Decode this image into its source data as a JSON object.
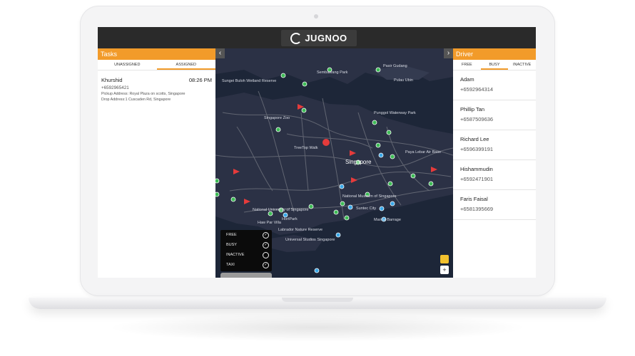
{
  "app": {
    "logo_text": "JUGNOO"
  },
  "tasks_panel": {
    "title": "Tasks",
    "tabs": [
      {
        "label": "UNASSIGNED",
        "active": false
      },
      {
        "label": "ASSIGNED",
        "active": true
      }
    ],
    "items": [
      {
        "name": "Khurshid",
        "time": "08:26 PM",
        "phone": "+6592965421",
        "pickup": "Pickup Address: Royal Plaza on scotts, Singapore",
        "drop": "Drop Address:1 Cuscaden Rd, Singapore"
      }
    ]
  },
  "driver_panel": {
    "title": "Driver",
    "tabs": [
      {
        "label": "FREE",
        "active": false
      },
      {
        "label": "BUSY",
        "active": true
      },
      {
        "label": "INACTIVE",
        "active": false
      }
    ],
    "drivers": [
      {
        "name": "Adam",
        "phone": "+6592964314"
      },
      {
        "name": "Phillip Tan",
        "phone": "+6587509636"
      },
      {
        "name": "Richard Lee",
        "phone": "+6596399191"
      },
      {
        "name": "Hishammudin",
        "phone": "+6592471901"
      },
      {
        "name": "Faris Faisal",
        "phone": "+6581395669"
      }
    ]
  },
  "map": {
    "nav_prev": "‹",
    "nav_next": "›",
    "zoom_in": "+",
    "labels": {
      "singapore": "Singapore",
      "pulau_ubin": "Pulau Ubin",
      "pasir_gudang": "Pasir Gudang",
      "sembawang_park": "Sembawang Park",
      "sungei_buloh": "Sungei Buloh Wetland Reserve",
      "singapore_zoo": "Singapore Zoo",
      "punggol": "Punggol Waterway Park",
      "treetop": "TreeTop Walk",
      "paya_lebar": "Paya Lebar Air Base",
      "hort_park": "HortPark",
      "labrador": "Labrador Nature Reserve",
      "national_museum": "National Museum of Singapore",
      "suntec": "Suntec City",
      "marina": "Marina Barrage",
      "universal": "Universal Studios Singapore",
      "nus": "National University of Singapore",
      "haw_par": "Haw Par Villa"
    },
    "legend": [
      {
        "label": "FREE",
        "checked": true
      },
      {
        "label": "BUSY",
        "checked": true
      },
      {
        "label": "INACTIVE",
        "checked": false
      },
      {
        "label": "TAXI",
        "checked": true
      }
    ],
    "colors": {
      "water": "#1d2638",
      "land": "#2b3145",
      "road": "#6b6f7a",
      "marker_green": "#3dbb55",
      "marker_red": "#e53b3b",
      "marker_blue": "#3aa8e8"
    }
  },
  "colors": {
    "accent": "#f29b2a",
    "topbar": "#2a2a2a"
  }
}
